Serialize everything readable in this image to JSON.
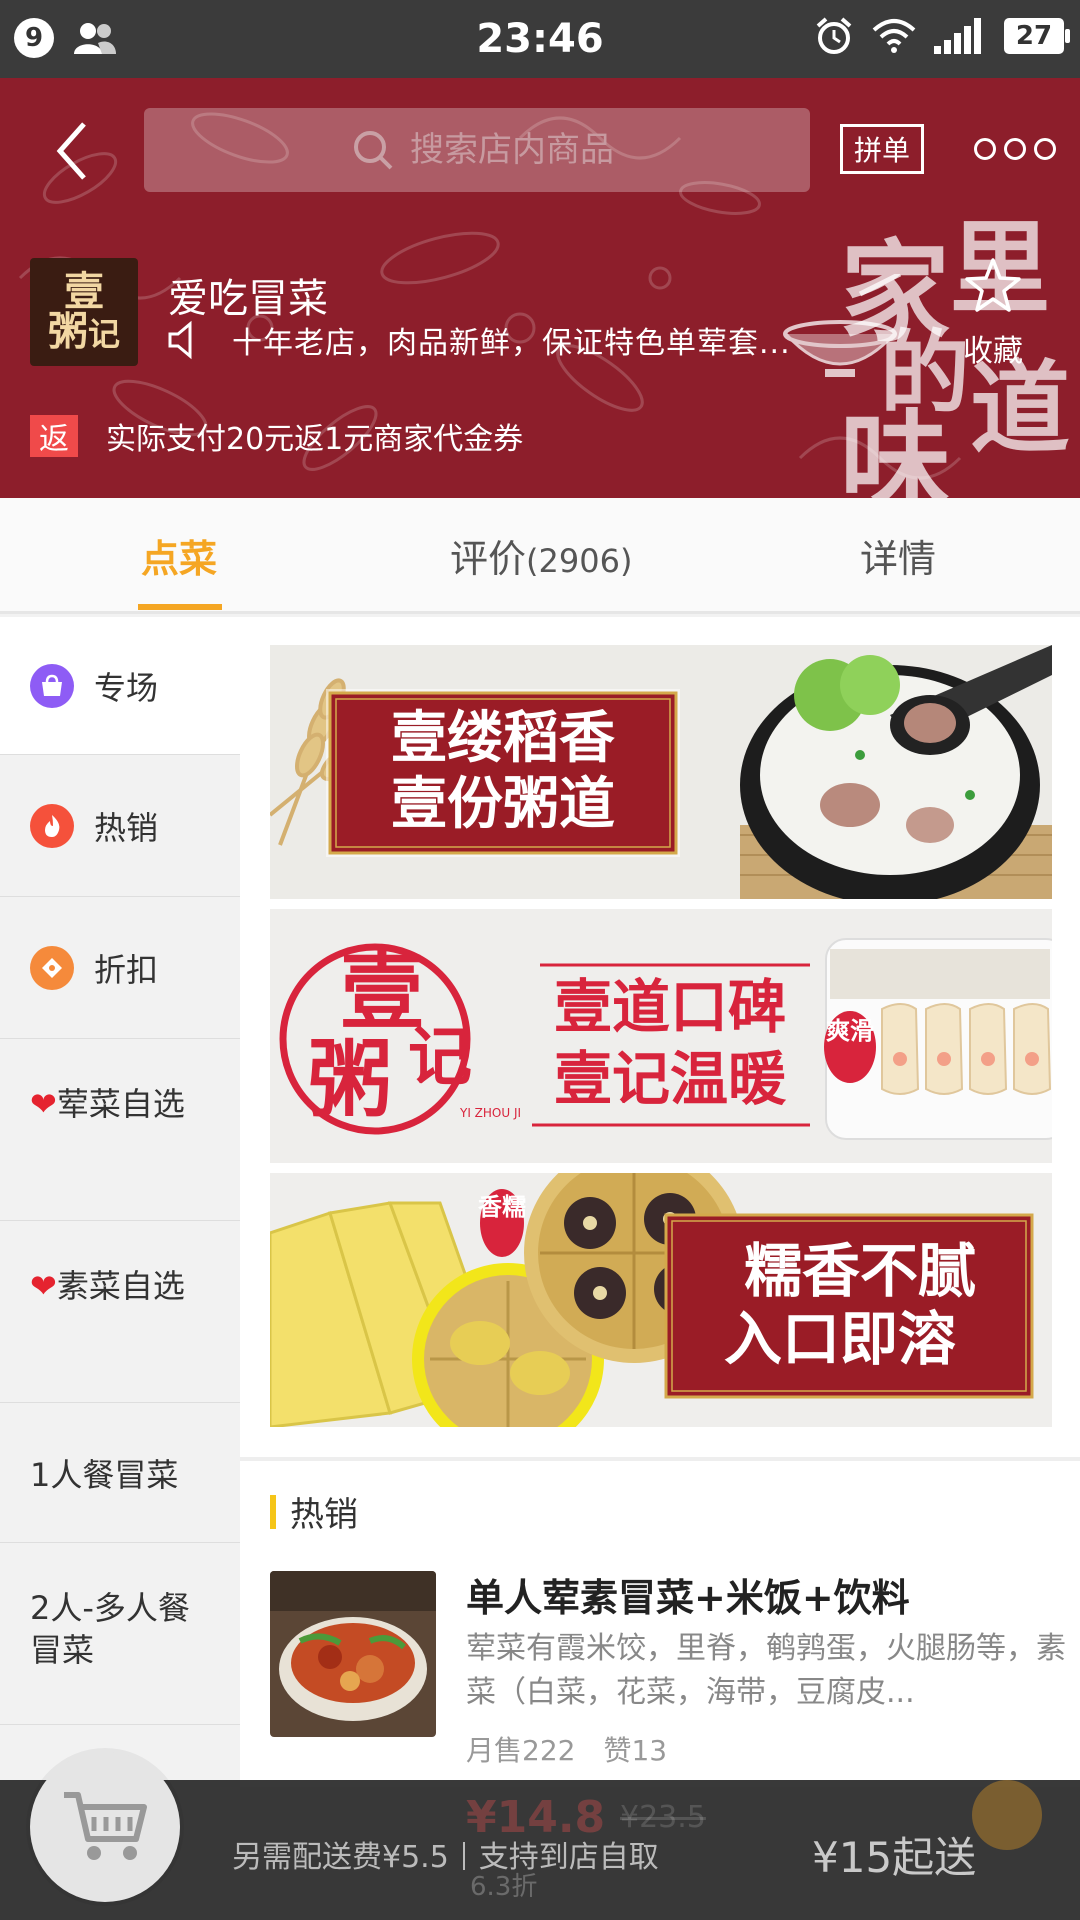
{
  "status_bar": {
    "notification_count": "9",
    "time": "23:46",
    "battery": "27"
  },
  "header": {
    "search_placeholder": "搜索店内商品",
    "group_order_label": "拼单",
    "shop_name": "爱吃冒菜",
    "notice": "十年老店，肉品新鲜，保证特色单荤套...",
    "promo_tag": "返",
    "promo_text": "实际支付20元返1元商家代金券",
    "favorite_label": "收藏",
    "logo_text": [
      "壹",
      "粥",
      "记"
    ],
    "brand_calligraphy": [
      "家",
      "里",
      "的",
      "味",
      "道"
    ],
    "colors": {
      "header_bg": "#8d1e2b",
      "accent": "#f5a623"
    }
  },
  "tabs": [
    {
      "label": "点菜",
      "count": ""
    },
    {
      "label": "评价",
      "count": "(2906)"
    },
    {
      "label": "详情",
      "count": ""
    }
  ],
  "sidebar": {
    "items": [
      {
        "label": "专场",
        "icon": "bag-icon"
      },
      {
        "label": "热销",
        "icon": "flame-icon"
      },
      {
        "label": "折扣",
        "icon": "discount-tag-icon"
      },
      {
        "label": "荤菜自选",
        "icon": "heart-icon"
      },
      {
        "label": "素菜自选",
        "icon": "heart-icon"
      },
      {
        "label": "1人餐冒菜",
        "icon": ""
      },
      {
        "label": "2人-多人餐冒菜",
        "icon": ""
      }
    ]
  },
  "banners": [
    {
      "line1": "壹缕稻香",
      "line2": "壹份粥道"
    },
    {
      "brand": "壹粥记",
      "brand_en": "YI ZHOU JI",
      "line1": "壹道口碑",
      "line2": "壹记温暖",
      "badge": "爽滑"
    },
    {
      "badge": "香糯",
      "line1": "糯香不腻",
      "line2": "入口即溶"
    }
  ],
  "section": {
    "title": "热销"
  },
  "product": {
    "title": "单人荤素冒菜+米饭+饮料",
    "desc": "荤菜有霞米饺，里脊，鹌鹑蛋，火腿肠等，素菜（白菜，花菜，海带，豆腐皮...",
    "monthly_sales": "月售222",
    "likes": "赞13",
    "price": "¥14.8",
    "original_price": "¥23.5",
    "discount": "6.3折"
  },
  "bottom_bar": {
    "delivery_fee": "另需配送费¥5.5",
    "pickup": "支持到店自取",
    "min_order": "¥15起送"
  }
}
